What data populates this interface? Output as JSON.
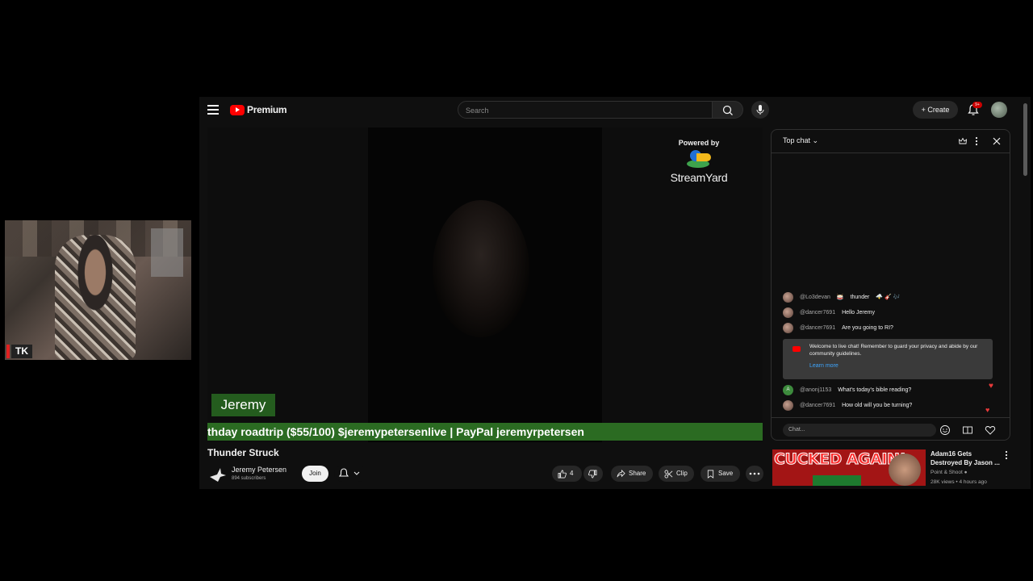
{
  "webcam": {
    "label": "TK"
  },
  "header": {
    "brand": "Premium",
    "search_placeholder": "Search",
    "create_label": "Create",
    "notification_count": "9+"
  },
  "video": {
    "powered_by": "Powered by",
    "streamyard": "StreamYard",
    "name_tag": "Jeremy",
    "ticker": "thday roadtrip ($55/100) $jeremypetersenlive | PayPal jeremyrpetersen",
    "title": "Thunder Struck"
  },
  "channel": {
    "name": "Jeremy Petersen",
    "subscribers": "894 subscribers",
    "join_label": "Join"
  },
  "actions": {
    "likes": "4",
    "share": "Share",
    "clip": "Clip",
    "save": "Save"
  },
  "chat": {
    "title": "Top chat",
    "messages": [
      {
        "author": "@Lo3devan",
        "text": "thunder"
      },
      {
        "author": "@dancer7691",
        "text": "Hello Jeremy"
      },
      {
        "author": "@dancer7691",
        "text": "Are you going to RI?"
      },
      {
        "author": "@anonj1153",
        "text": "What's today's bible reading?"
      },
      {
        "author": "@dancer7691",
        "text": "How old will you be turning?"
      }
    ],
    "welcome_text": "Welcome to live chat! Remember to guard your privacy and abide by our community guidelines.",
    "learn_more": "Learn more",
    "input_placeholder": "Chat..."
  },
  "recommendation": {
    "thumb_text": "CUCKED AGAIN!",
    "title": "Adam16 Gets Destroyed By Jason ...",
    "channel": "Point & Shoot",
    "meta": "28K views • 4 hours ago"
  },
  "colors": {
    "youtube_red": "#ff0000",
    "ticker_green": "#2b6b22",
    "link_blue": "#3ea6ff"
  }
}
